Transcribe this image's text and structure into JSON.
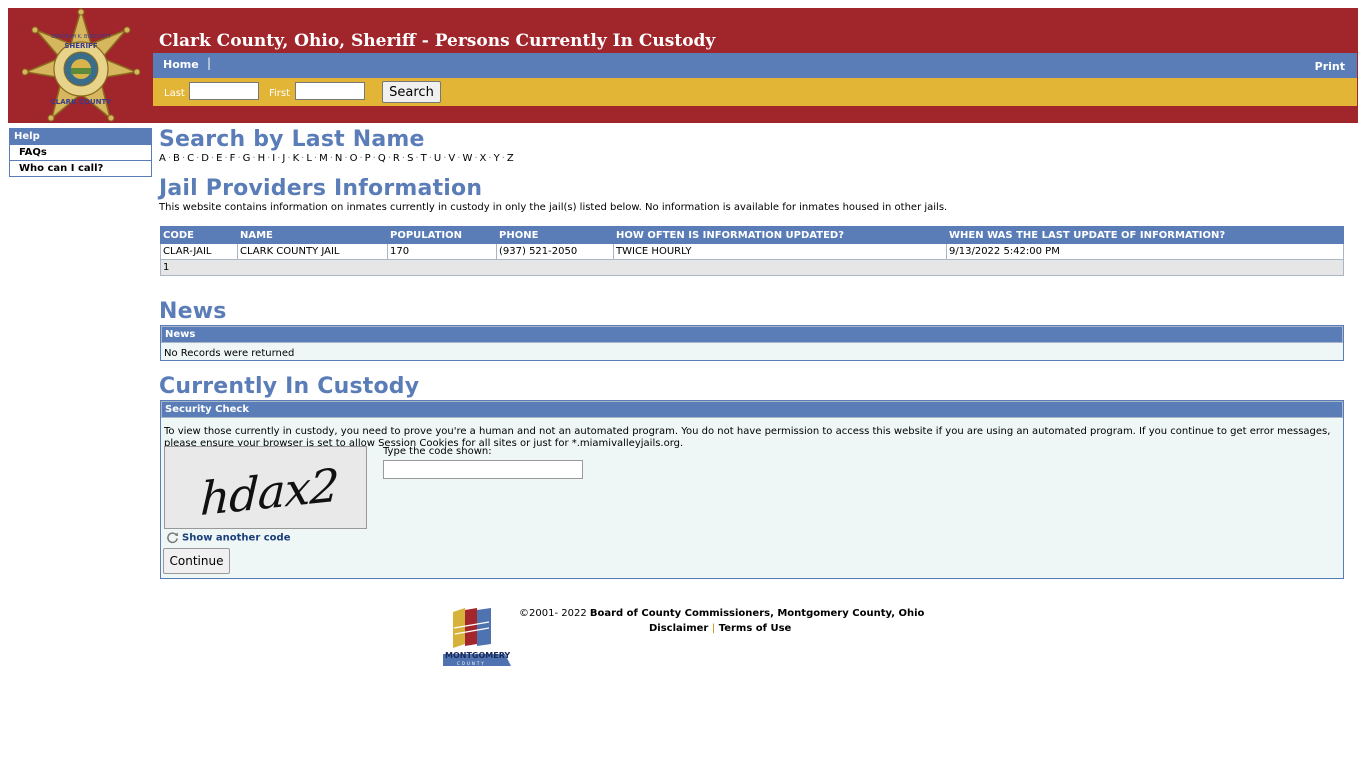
{
  "header": {
    "title": "Clark County, Ohio, Sheriff - Persons Currently In Custody",
    "badge_lines": [
      "DEBORAH K. BURCHETT",
      "SHERIFF",
      "CLARK COUNTY"
    ],
    "nav": {
      "home": "Home",
      "separator": "|",
      "print": "Print"
    },
    "search": {
      "last_label": "Last",
      "first_label": "First",
      "last_value": "",
      "first_value": "",
      "button": "Search"
    }
  },
  "sidebar": {
    "help": "Help",
    "items": [
      {
        "label": "FAQs"
      },
      {
        "label": "Who can I call?"
      }
    ]
  },
  "search_by_last_name": {
    "heading": "Search by Last Name",
    "letters": [
      "A",
      "B",
      "C",
      "D",
      "E",
      "F",
      "G",
      "H",
      "I",
      "J",
      "K",
      "L",
      "M",
      "N",
      "O",
      "P",
      "Q",
      "R",
      "S",
      "T",
      "U",
      "V",
      "W",
      "X",
      "Y",
      "Z"
    ]
  },
  "jail_providers": {
    "heading": "Jail Providers Information",
    "description": "This website contains information on inmates currently in custody in only the jail(s) listed below. No information is available for inmates housed in other jails.",
    "columns": [
      "CODE",
      "NAME",
      "POPULATION",
      "PHONE",
      "HOW OFTEN IS INFORMATION UPDATED?",
      "WHEN WAS THE LAST UPDATE OF INFORMATION?"
    ],
    "rows": [
      [
        "CLAR-JAIL",
        "CLARK COUNTY JAIL",
        "170",
        "(937) 521-2050",
        "TWICE HOURLY",
        "9/13/2022 5:42:00 PM"
      ]
    ],
    "pager": "1"
  },
  "news": {
    "heading": "News",
    "panel_title": "News",
    "empty_text": "No Records were returned"
  },
  "custody": {
    "heading": "Currently In Custody",
    "panel_title": "Security Check",
    "message": "To view those currently in custody, you need to prove you're a human and not an automated program. You do not have permission to access this website if you are using an automated program. If you continue to get error messages, please ensure your browser is set to allow Session Cookies for all sites or just for *.miamivalleyjails.org.",
    "captcha_text": "hdax2",
    "code_label": "Type the code shown:",
    "code_value": "",
    "another_code": "Show another code",
    "continue_button": "Continue"
  },
  "footer": {
    "copyright_prefix": "©2001- 2022",
    "org": "Board of County Commissioners, Montgomery County, Ohio",
    "disclaimer": "Disclaimer",
    "separator": "|",
    "terms": "Terms of Use",
    "logo_text": "MONTGOMERY",
    "logo_subtext": "COUNTY"
  },
  "colors": {
    "header_red": "#a0262c",
    "nav_blue": "#5a7db8",
    "search_gold": "#e3b536",
    "panel_bg": "#eef6f6"
  }
}
